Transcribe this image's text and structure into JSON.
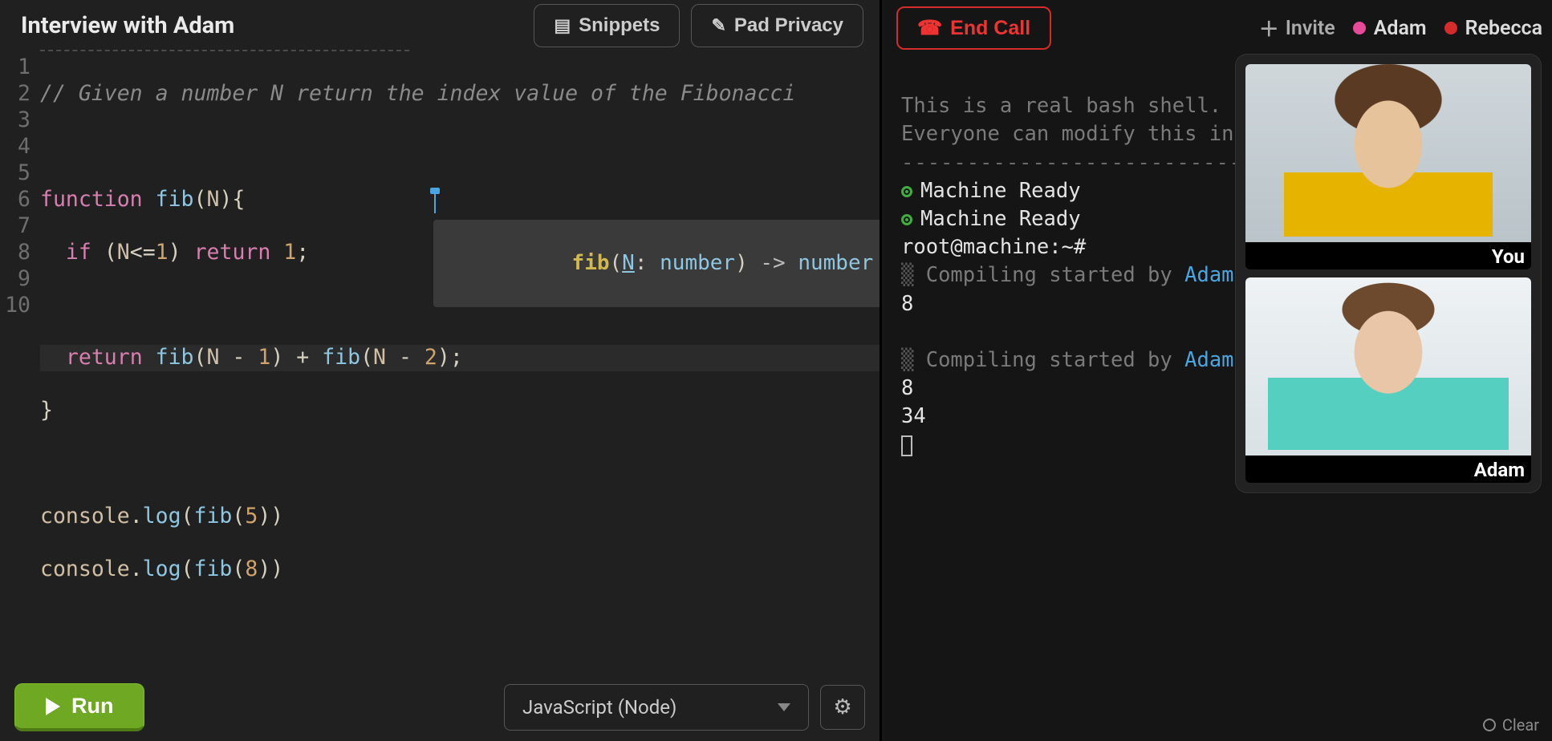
{
  "header": {
    "title": "Interview with Adam",
    "snippets_label": "Snippets",
    "privacy_label": "Pad Privacy"
  },
  "editor": {
    "line_count": 10,
    "comment_text": "// Given a number N return the index value of the Fibonacci",
    "hint_fn": "fib",
    "hint_param": "N",
    "hint_param_type": "number",
    "hint_return_type": "number"
  },
  "footer": {
    "run_label": "Run",
    "language": "JavaScript (Node)"
  },
  "call": {
    "end_label": "End Call",
    "invite_label": "Invite",
    "participants": [
      {
        "name": "Adam",
        "color": "pink"
      },
      {
        "name": "Rebecca",
        "color": "red"
      }
    ]
  },
  "terminal": {
    "intro_line1": "This is a real bash shell.",
    "intro_line2": "Everyone can modify this in",
    "ready_text": "Machine Ready",
    "prompt": "root@machine:~#",
    "compile_prefix": "Compiling started by ",
    "compile_user": "Adam",
    "outputs_run1": [
      "8"
    ],
    "outputs_run2": [
      "8",
      "34"
    ],
    "clear_label": "Clear"
  },
  "videos": {
    "tile1_label": "You",
    "tile2_label": "Adam"
  }
}
